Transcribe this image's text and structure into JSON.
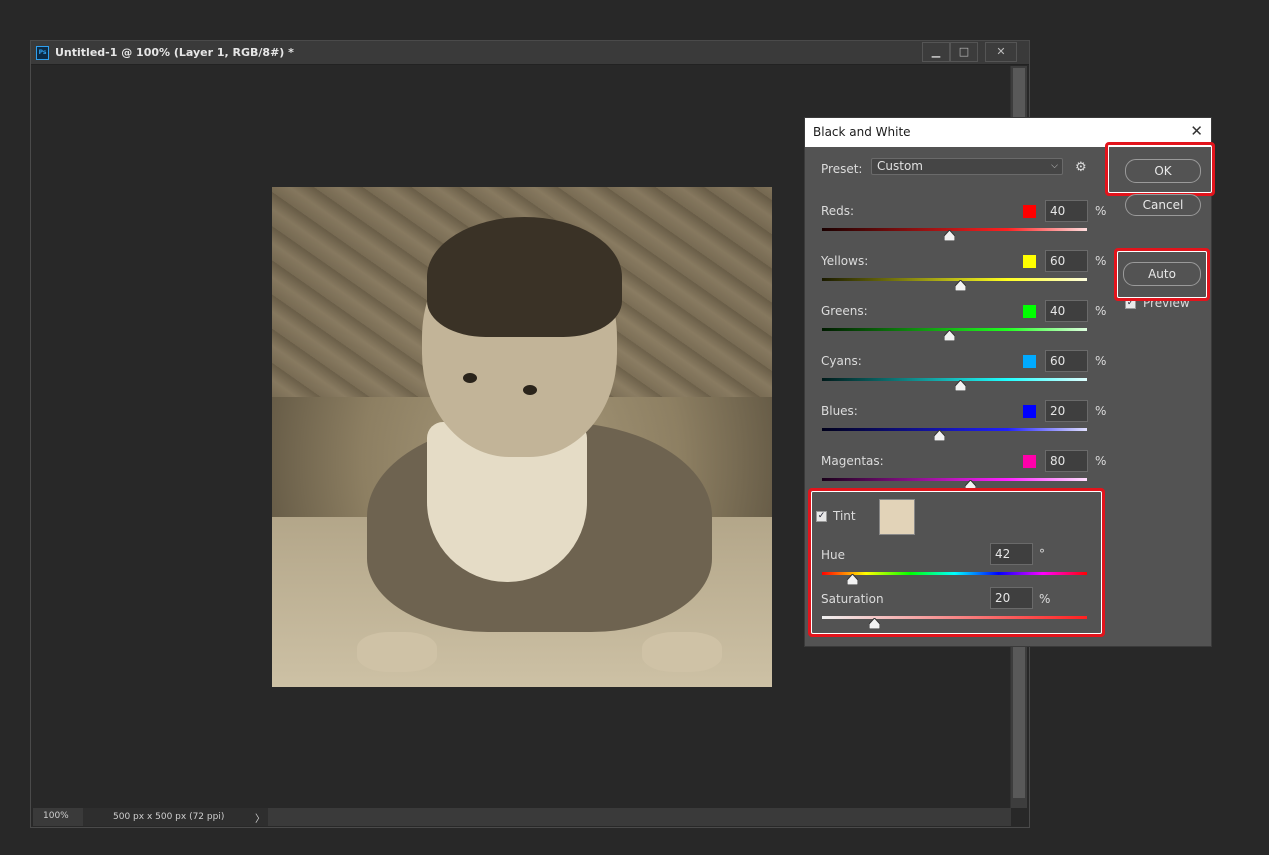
{
  "document": {
    "title": "Untitled-1 @ 100% (Layer 1, RGB/8#) *",
    "app_icon": "Ps",
    "zoom": "100%",
    "doc_info": "500 px x 500 px (72 ppi)",
    "status_arrow": "〉",
    "minimize_glyph": "▁",
    "maximize_glyph": "□",
    "close_glyph": "✕"
  },
  "dialog": {
    "title": "Black and White",
    "close_glyph": "✕",
    "preset_label": "Preset:",
    "preset_value": "Custom",
    "preset_chevron": "⌵",
    "gear_glyph": "⚙",
    "ok_label": "OK",
    "cancel_label": "Cancel",
    "auto_label": "Auto",
    "preview_label": "Preview",
    "preview_checked": true,
    "channels": [
      {
        "label": "Reds:",
        "value": "40",
        "unit": "%",
        "color": "#ff0000",
        "percent": 40
      },
      {
        "label": "Yellows:",
        "value": "60",
        "unit": "%",
        "color": "#ffff00",
        "percent": 60
      },
      {
        "label": "Greens:",
        "value": "40",
        "unit": "%",
        "color": "#00ff00",
        "percent": 40
      },
      {
        "label": "Cyans:",
        "value": "60",
        "unit": "%",
        "color": "#00aaff",
        "percent": 60
      },
      {
        "label": "Blues:",
        "value": "20",
        "unit": "%",
        "color": "#0000ff",
        "percent": 20
      },
      {
        "label": "Magentas:",
        "value": "80",
        "unit": "%",
        "color": "#ff00aa",
        "percent": 80
      }
    ],
    "tint": {
      "label": "Tint",
      "checked": true,
      "swatch_color": "#e2d3b8",
      "hue_label": "Hue",
      "hue_value": "42",
      "hue_unit": "°",
      "saturation_label": "Saturation",
      "saturation_value": "20",
      "saturation_unit": "%"
    }
  },
  "colors": {
    "highlight": "#e2141c",
    "dialog_bg": "#535353",
    "app_bg": "#282828"
  }
}
